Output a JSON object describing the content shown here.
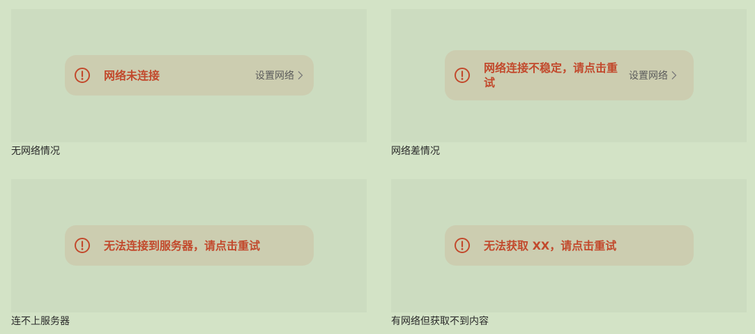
{
  "panels": [
    {
      "caption": "无网络情况",
      "message": "网络未连接",
      "action_label": "设置网络"
    },
    {
      "caption": "网络差情况",
      "message": "网络连接不稳定，请点击重试",
      "action_label": "设置网络"
    },
    {
      "caption": "连不上服务器",
      "message": "无法连接到服务器，请点击重试"
    },
    {
      "caption": "有网络但获取不到内容",
      "message": "无法获取 XX，请点击重试"
    }
  ],
  "icons": {
    "alert": "alert-circle-icon",
    "chevron": "chevron-right-icon"
  },
  "colors": {
    "page_background": "#d3e3c6",
    "panel_background": "#ccdcc0",
    "toast_background": "#cccdb0",
    "error_text": "#c2492c",
    "action_text": "#5b5b5b"
  }
}
